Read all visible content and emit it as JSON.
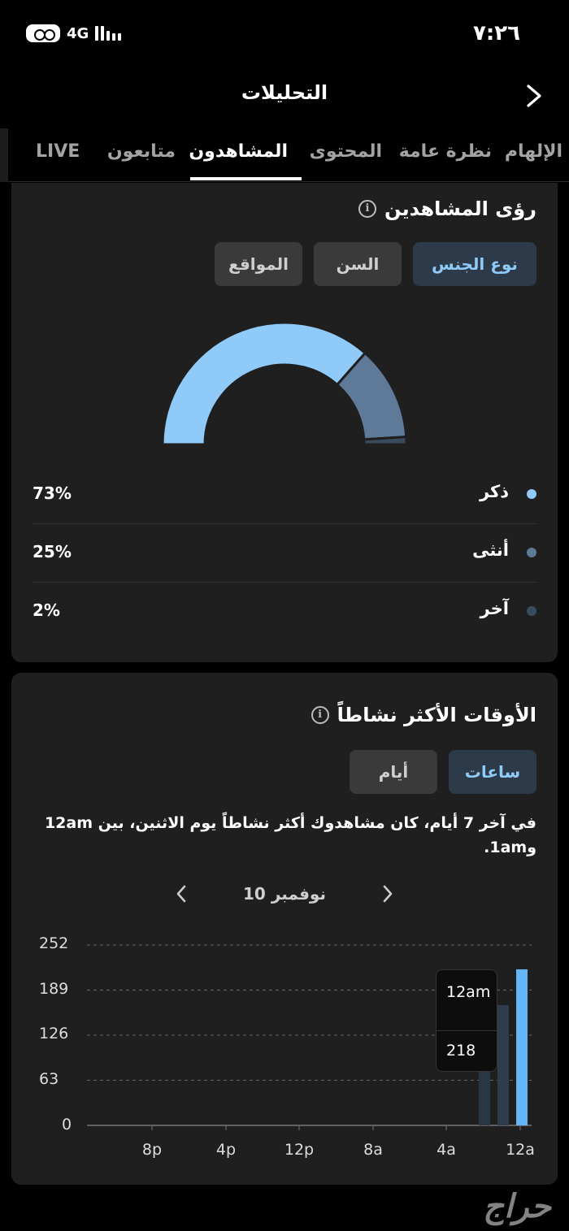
{
  "status_bar": {
    "network": "4G",
    "time": "٧:٢٦"
  },
  "header": {
    "title": "التحليلات"
  },
  "tabs": [
    {
      "label": "الإلهام"
    },
    {
      "label": "نظرة عامة"
    },
    {
      "label": "المحتوى"
    },
    {
      "label": "المشاهدون"
    },
    {
      "label": "متابعون"
    },
    {
      "label": "LIVE"
    }
  ],
  "viewer_insights": {
    "title": "رؤى المشاهدين",
    "filters": [
      {
        "label": "نوع الجنس"
      },
      {
        "label": "السن"
      },
      {
        "label": "المواقع"
      }
    ],
    "legend": [
      {
        "label": "ذكر",
        "percent": "73%",
        "color": "#90caf9"
      },
      {
        "label": "أنثى",
        "percent": "25%",
        "color": "#5f7a99"
      },
      {
        "label": "آخر",
        "percent": "2%",
        "color": "#3a4b5e"
      }
    ]
  },
  "active_times": {
    "title": "الأوقات الأكثر نشاطاً",
    "filters": [
      {
        "label": "ساعات"
      },
      {
        "label": "أيام"
      }
    ],
    "description": "في آخر 7 أيام، كان مشاهدوك أكثر نشاطاً يوم الاثنين، بين 12am و1am.",
    "date": "10 نوفمبر",
    "tooltip": {
      "time": "12am",
      "value": "218"
    }
  },
  "chart_data": {
    "type": "bar",
    "yticks": [
      "252",
      "189",
      "126",
      "63",
      "0"
    ],
    "xticks": [
      "8p",
      "4p",
      "12p",
      "8a",
      "4a",
      "12a"
    ],
    "ylim": [
      0,
      252
    ],
    "grid": true,
    "series": [
      {
        "values": [
          {
            "slot": "12a",
            "value": 218,
            "color": "#64b5f6"
          },
          {
            "slot": "1a",
            "value": 168,
            "color": "#2e3c4c"
          },
          {
            "slot": "2a",
            "value": 95,
            "color": "#2a3644"
          }
        ]
      }
    ]
  },
  "watermark": "حراج"
}
